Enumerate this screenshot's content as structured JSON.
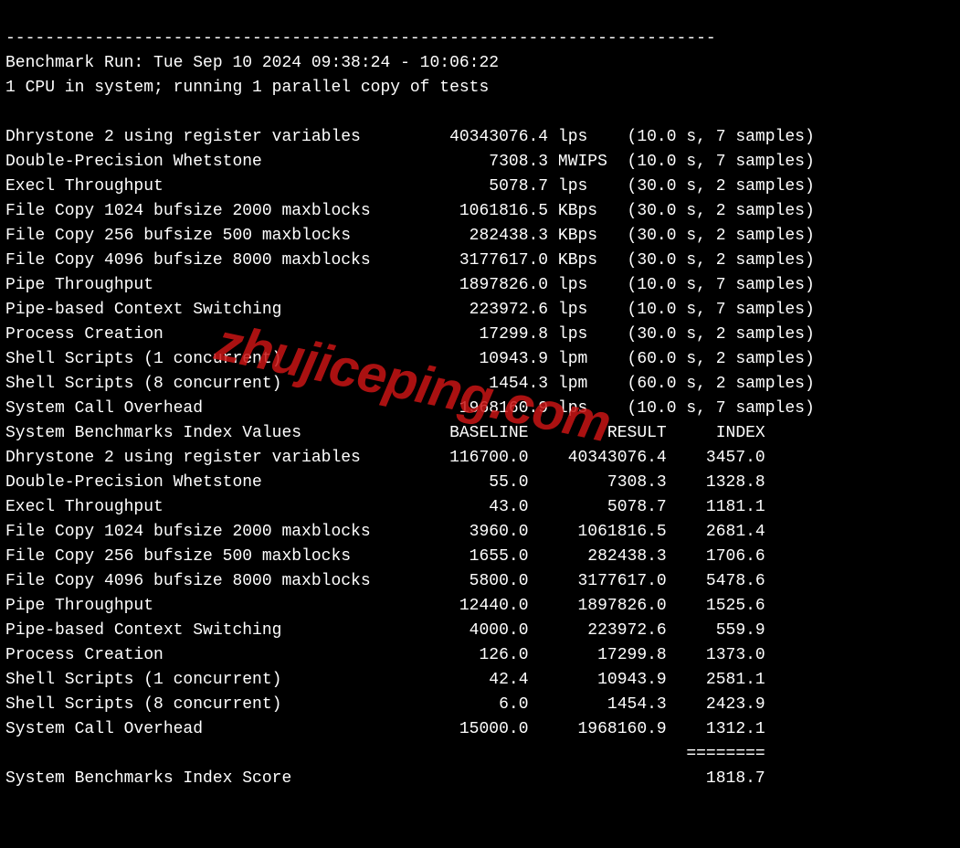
{
  "separator": "------------------------------------------------------------------------",
  "header": {
    "run_line": "Benchmark Run: Tue Sep 10 2024 09:38:24 - 10:06:22",
    "cpu_line": "1 CPU in system; running 1 parallel copy of tests"
  },
  "results": [
    {
      "name": "Dhrystone 2 using register variables",
      "value": "40343076.4",
      "unit": "lps",
      "timing": "(10.0 s, 7 samples)"
    },
    {
      "name": "Double-Precision Whetstone",
      "value": "7308.3",
      "unit": "MWIPS",
      "timing": "(10.0 s, 7 samples)"
    },
    {
      "name": "Execl Throughput",
      "value": "5078.7",
      "unit": "lps",
      "timing": "(30.0 s, 2 samples)"
    },
    {
      "name": "File Copy 1024 bufsize 2000 maxblocks",
      "value": "1061816.5",
      "unit": "KBps",
      "timing": "(30.0 s, 2 samples)"
    },
    {
      "name": "File Copy 256 bufsize 500 maxblocks",
      "value": "282438.3",
      "unit": "KBps",
      "timing": "(30.0 s, 2 samples)"
    },
    {
      "name": "File Copy 4096 bufsize 8000 maxblocks",
      "value": "3177617.0",
      "unit": "KBps",
      "timing": "(30.0 s, 2 samples)"
    },
    {
      "name": "Pipe Throughput",
      "value": "1897826.0",
      "unit": "lps",
      "timing": "(10.0 s, 7 samples)"
    },
    {
      "name": "Pipe-based Context Switching",
      "value": "223972.6",
      "unit": "lps",
      "timing": "(10.0 s, 7 samples)"
    },
    {
      "name": "Process Creation",
      "value": "17299.8",
      "unit": "lps",
      "timing": "(30.0 s, 2 samples)"
    },
    {
      "name": "Shell Scripts (1 concurrent)",
      "value": "10943.9",
      "unit": "lpm",
      "timing": "(60.0 s, 2 samples)"
    },
    {
      "name": "Shell Scripts (8 concurrent)",
      "value": "1454.3",
      "unit": "lpm",
      "timing": "(60.0 s, 2 samples)"
    },
    {
      "name": "System Call Overhead",
      "value": "1968160.9",
      "unit": "lps",
      "timing": "(10.0 s, 7 samples)"
    }
  ],
  "index_header": {
    "title": "System Benchmarks Index Values",
    "col_baseline": "BASELINE",
    "col_result": "RESULT",
    "col_index": "INDEX"
  },
  "index_rows": [
    {
      "name": "Dhrystone 2 using register variables",
      "baseline": "116700.0",
      "result": "40343076.4",
      "index": "3457.0"
    },
    {
      "name": "Double-Precision Whetstone",
      "baseline": "55.0",
      "result": "7308.3",
      "index": "1328.8"
    },
    {
      "name": "Execl Throughput",
      "baseline": "43.0",
      "result": "5078.7",
      "index": "1181.1"
    },
    {
      "name": "File Copy 1024 bufsize 2000 maxblocks",
      "baseline": "3960.0",
      "result": "1061816.5",
      "index": "2681.4"
    },
    {
      "name": "File Copy 256 bufsize 500 maxblocks",
      "baseline": "1655.0",
      "result": "282438.3",
      "index": "1706.6"
    },
    {
      "name": "File Copy 4096 bufsize 8000 maxblocks",
      "baseline": "5800.0",
      "result": "3177617.0",
      "index": "5478.6"
    },
    {
      "name": "Pipe Throughput",
      "baseline": "12440.0",
      "result": "1897826.0",
      "index": "1525.6"
    },
    {
      "name": "Pipe-based Context Switching",
      "baseline": "4000.0",
      "result": "223972.6",
      "index": "559.9"
    },
    {
      "name": "Process Creation",
      "baseline": "126.0",
      "result": "17299.8",
      "index": "1373.0"
    },
    {
      "name": "Shell Scripts (1 concurrent)",
      "baseline": "42.4",
      "result": "10943.9",
      "index": "2581.1"
    },
    {
      "name": "Shell Scripts (8 concurrent)",
      "baseline": "6.0",
      "result": "1454.3",
      "index": "2423.9"
    },
    {
      "name": "System Call Overhead",
      "baseline": "15000.0",
      "result": "1968160.9",
      "index": "1312.1"
    }
  ],
  "score_divider": "========",
  "score": {
    "label": "System Benchmarks Index Score",
    "value": "1818.7"
  },
  "watermark": "zhujiceping.com"
}
